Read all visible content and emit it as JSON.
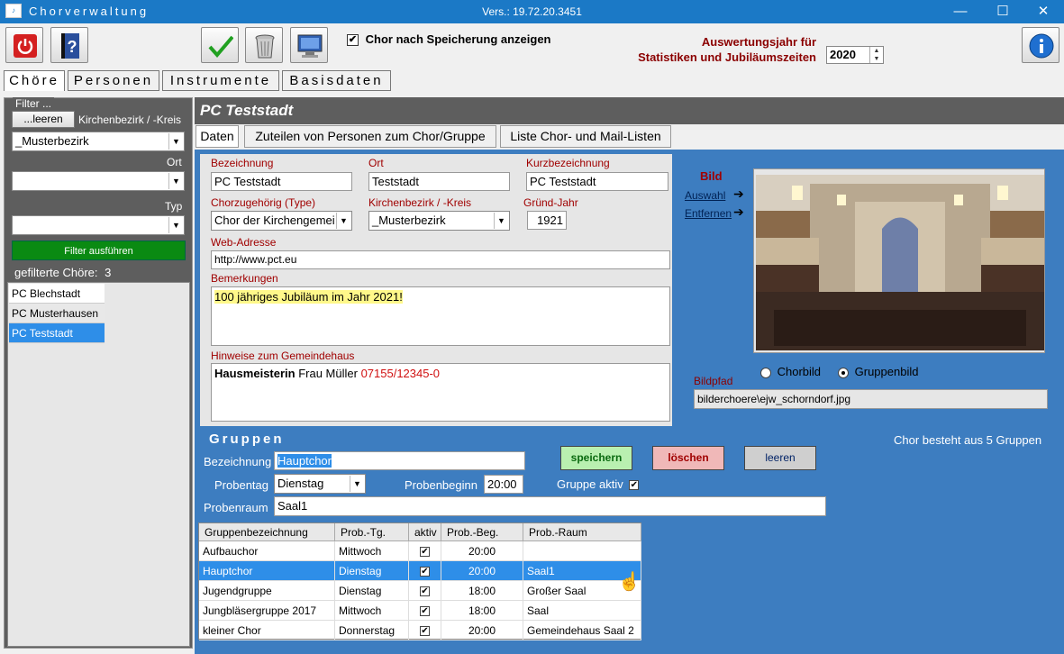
{
  "window": {
    "title": "Chorverwaltung",
    "version": "Vers.: 19.72.20.3451",
    "min": "—",
    "max": "☐",
    "close": "✕"
  },
  "toolbar": {
    "show_after_save": "Chor nach Speicherung anzeigen",
    "show_after_save_checked": "✔",
    "eval_label_1": "Auswertungsjahr für",
    "eval_label_2": "Statistiken und Jubiläumszeiten",
    "year": "2020"
  },
  "main_tabs": [
    "Chöre",
    "Personen",
    "Instrumente",
    "Basisdaten"
  ],
  "filter": {
    "legend": "Filter ...",
    "clear": "...leeren",
    "kreis_label": "Kirchenbezirk / -Kreis",
    "kreis_value": "_Musterbezirk",
    "ort_label": "Ort",
    "ort_value": "",
    "typ_label": "Typ",
    "typ_value": "",
    "run": "Filter ausführen",
    "count_label": "gefilterte Chöre:",
    "count": "3",
    "choirs": [
      "PC Blechstadt",
      "PC Musterhausen",
      "PC Teststadt"
    ]
  },
  "choir": {
    "header": "PC Teststadt",
    "subtabs": [
      "Daten",
      "Zuteilen von Personen zum Chor/Gruppe",
      "Liste Chor- und Mail-Listen"
    ],
    "labels": {
      "bezeichnung": "Bezeichnung",
      "ort": "Ort",
      "kurz": "Kurzbezeichnung",
      "type": "Chorzugehörig (Type)",
      "kreis": "Kirchenbezirk / -Kreis",
      "jahr": "Gründ-Jahr",
      "web": "Web-Adresse",
      "bemerkungen": "Bemerkungen",
      "hinweise": "Hinweise zum Gemeindehaus"
    },
    "values": {
      "bezeichnung": "PC Teststadt",
      "ort": "Teststadt",
      "kurz": "PC Teststadt",
      "type": "Chor der Kirchengemei",
      "kreis": "_Musterbezirk",
      "jahr": "1921",
      "web": "http://www.pct.eu",
      "bemerkungen": "100 jähriges Jubiläum im Jahr 2021!",
      "hinweis_bold": "Hausmeisterin",
      "hinweis_name": " Frau Müller ",
      "hinweis_phone": "07155/12345-0"
    }
  },
  "bild": {
    "title": "Bild",
    "auswahl": "Auswahl",
    "entfernen": "Entfernen",
    "radio_chor": "Chorbild",
    "radio_gruppe": "Gruppenbild",
    "pfad_label": "Bildpfad",
    "pfad": "bilderchoere\\ejw_schorndorf.jpg"
  },
  "gruppen": {
    "title": "Gruppen",
    "summary": "Chor besteht aus 5 Gruppen",
    "bez_label": "Bezeichnung",
    "bez_value": "Hauptchor",
    "probentag_label": "Probentag",
    "probentag_value": "Dienstag",
    "probenbeginn_label": "Probenbeginn",
    "probenbeginn_value": "20:00",
    "aktiv_label": "Gruppe aktiv",
    "probenraum_label": "Probenraum",
    "probenraum_value": "Saal1",
    "btn_save": "speichern",
    "btn_delete": "löschen",
    "btn_clear": "leeren",
    "columns": [
      "Gruppenbezeichnung",
      "Prob.-Tg.",
      "aktiv",
      "Prob.-Beg.",
      "Prob.-Raum"
    ],
    "rows": [
      [
        "Aufbauchor",
        "Mittwoch",
        "✔",
        "20:00",
        ""
      ],
      [
        "Hauptchor",
        "Dienstag",
        "✔",
        "20:00",
        "Saal1"
      ],
      [
        "Jugendgruppe",
        "Dienstag",
        "✔",
        "18:00",
        "Großer Saal"
      ],
      [
        "Jungbläsergruppe 2017",
        "Mittwoch",
        "✔",
        "18:00",
        "Saal"
      ],
      [
        "kleiner Chor",
        "Donnerstag",
        "✔",
        "20:00",
        "Gemeindehaus Saal 2"
      ]
    ]
  },
  "colors": {
    "titlebar": "#1b79c6",
    "panel_blue": "#3d7dc0",
    "header_grey": "#5e5e5e",
    "label_red": "#a00000",
    "run_green": "#0a8a12"
  }
}
